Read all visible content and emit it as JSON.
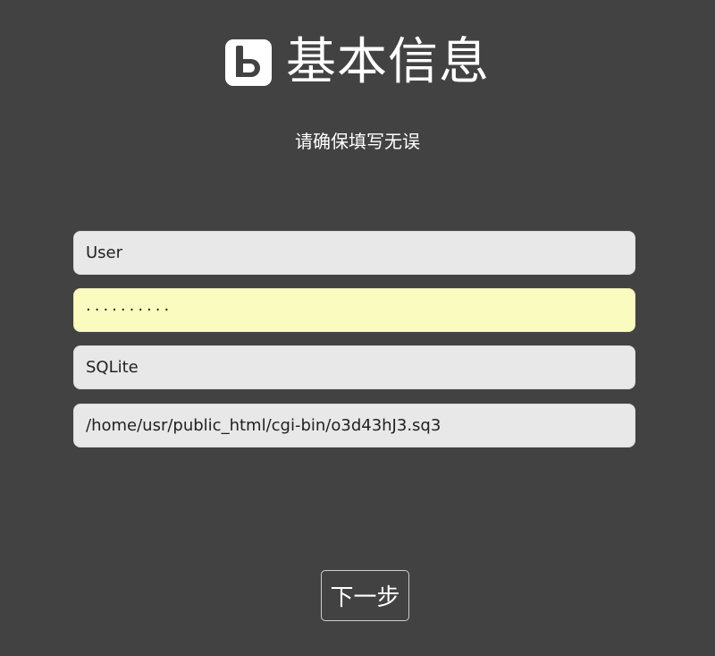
{
  "header": {
    "logo_icon": "b-logo-icon",
    "title": "基本信息"
  },
  "subtitle": "请确保填写无误",
  "form": {
    "username": "User",
    "password_mask": "··········",
    "db_type": "SQLite",
    "db_path": "/home/usr/public_html/cgi-bin/o3d43hJ3.sq3"
  },
  "actions": {
    "next_label": "下一步"
  },
  "colors": {
    "background": "#424242",
    "input_bg": "#e8e8e8",
    "password_bg": "#fafbbf",
    "text_light": "#ffffff"
  }
}
